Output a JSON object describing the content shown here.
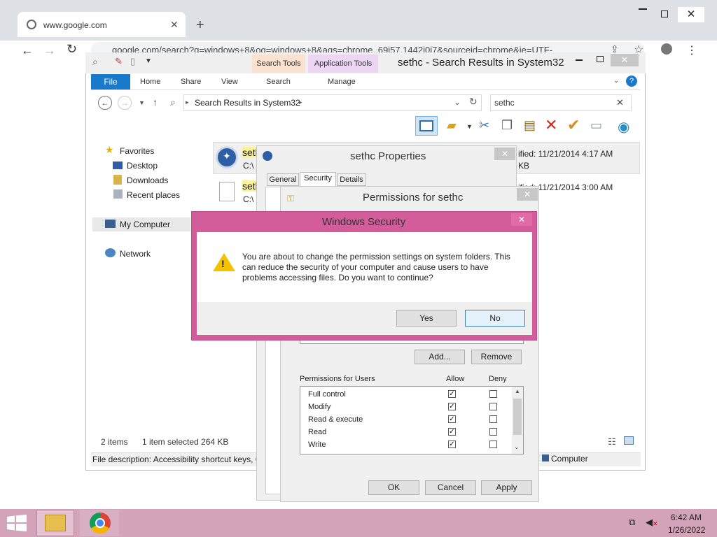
{
  "chrome": {
    "tab_title": "www.google.com",
    "tab_close": "✕",
    "new_tab": "+",
    "url": "google.com/search?q=windows+8&oq=windows+8&aqs=chrome..69i57.1442j0j7&sourceid=chrome&ie=UTF-",
    "menu": "⋮"
  },
  "explorer": {
    "title": "sethc - Search Results in System32",
    "context_search_tools": "Search Tools",
    "context_application_tools": "Application Tools",
    "ribbon": {
      "file": "File",
      "home": "Home",
      "share": "Share",
      "view": "View",
      "search": "Search",
      "manage": "Manage"
    },
    "address": "Search Results in System32",
    "search_value": "sethc",
    "nav": {
      "favorites": "Favorites",
      "desktop": "Desktop",
      "downloads": "Downloads",
      "recent": "Recent places",
      "my_computer": "My Computer",
      "network": "Network"
    },
    "files": [
      {
        "name": "seth",
        "path": "C:\\",
        "modified": "ified: 11/21/2014 4:17 AM",
        "size": "KB"
      },
      {
        "name": "seth",
        "path": "C:\\",
        "modified": "ified: 11/21/2014 3:00 AM"
      }
    ],
    "status_items": "2 items",
    "status_selected": "1 item selected  264 KB",
    "details_text": "File description: Accessibility shortcut keys, C",
    "details_right": "Computer"
  },
  "properties": {
    "title": "sethc Properties",
    "tabs": [
      "General",
      "Security",
      "Details"
    ]
  },
  "permissions": {
    "title": "Permissions for sethc",
    "add": "Add...",
    "remove": "Remove",
    "list_header": "Permissions for Users",
    "allow": "Allow",
    "deny": "Deny",
    "rows": [
      {
        "name": "Full control",
        "allow": true,
        "deny": false
      },
      {
        "name": "Modify",
        "allow": true,
        "deny": false
      },
      {
        "name": "Read & execute",
        "allow": true,
        "deny": false
      },
      {
        "name": "Read",
        "allow": true,
        "deny": false
      },
      {
        "name": "Write",
        "allow": true,
        "deny": false
      }
    ],
    "ok": "OK",
    "cancel": "Cancel",
    "apply": "Apply"
  },
  "security_dialog": {
    "title": "Windows Security",
    "message": "You are about to change the permission settings on system folders. This can reduce the security of your computer and cause users to have problems accessing files. Do you want to continue?",
    "yes": "Yes",
    "no": "No"
  },
  "taskbar": {
    "time": "6:42 AM",
    "date": "1/26/2022"
  }
}
